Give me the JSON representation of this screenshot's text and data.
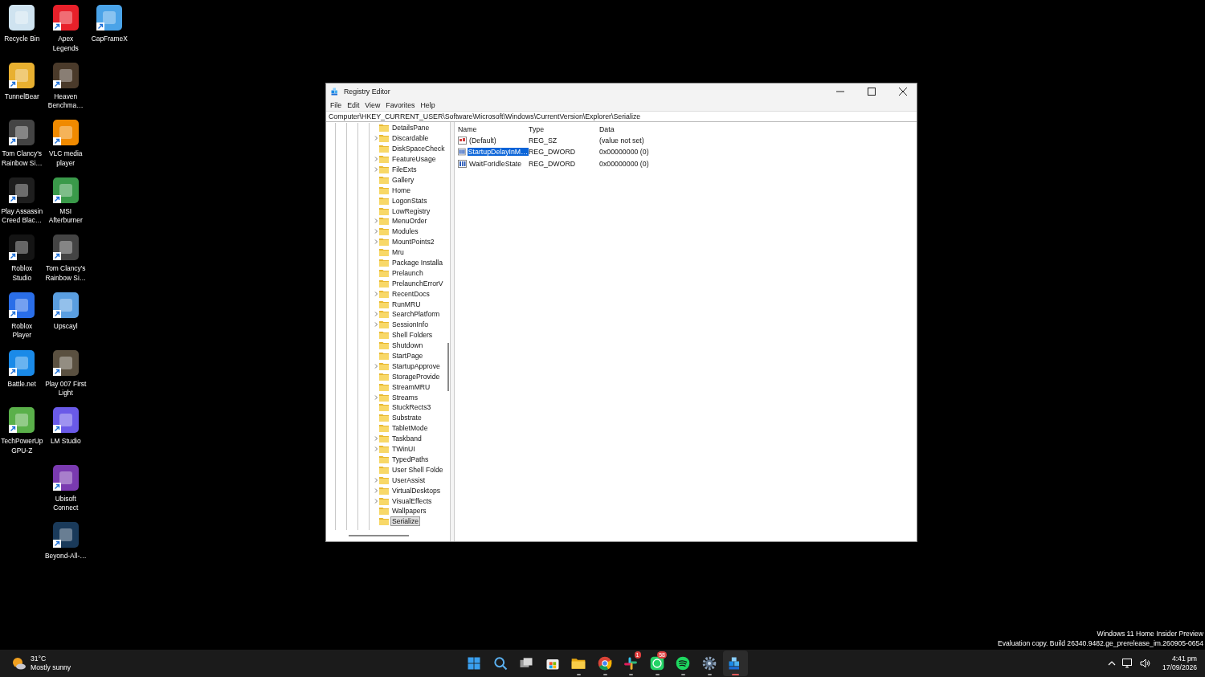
{
  "desktop": {
    "columns": [
      {
        "icons": [
          {
            "label": "Recycle Bin",
            "color": "#cfe3f0",
            "shortcut": false
          },
          {
            "label": "TunnelBear",
            "color": "#e8b030",
            "shortcut": true
          },
          {
            "label": "Tom Clancy's Rainbow Si…",
            "color": "#444444",
            "shortcut": true
          },
          {
            "label": "Play Assassin Creed Blac…",
            "color": "#1e1e1e",
            "shortcut": true
          },
          {
            "label": "Roblox Studio",
            "color": "#141414",
            "shortcut": true
          },
          {
            "label": "Roblox Player",
            "color": "#2a6ee8",
            "shortcut": true
          },
          {
            "label": "Battle.net",
            "color": "#1a8ae8",
            "shortcut": true
          },
          {
            "label": "TechPowerUp GPU-Z",
            "color": "#5ab04a",
            "shortcut": true
          }
        ]
      },
      {
        "icons": [
          {
            "label": "Apex Legends",
            "color": "#e8202a",
            "shortcut": true
          },
          {
            "label": "Heaven Benchma…",
            "color": "#4a3a2a",
            "shortcut": true
          },
          {
            "label": "VLC media player",
            "color": "#f08a00",
            "shortcut": true
          },
          {
            "label": "MSI Afterburner",
            "color": "#3a9a4a",
            "shortcut": true
          },
          {
            "label": "Tom Clancy's Rainbow Si…",
            "color": "#444444",
            "shortcut": true
          },
          {
            "label": "Upscayl",
            "color": "#5a9ee0",
            "shortcut": true
          },
          {
            "label": "Play 007 First Light",
            "color": "#5a5040",
            "shortcut": true
          },
          {
            "label": "LM Studio",
            "color": "#6a5ae8",
            "shortcut": true
          },
          {
            "label": "Ubisoft Connect",
            "color": "#7a3ab0",
            "shortcut": true
          },
          {
            "label": "Beyond-All-…",
            "color": "#1a3a5a",
            "shortcut": true
          }
        ]
      },
      {
        "icons": [
          {
            "label": "CapFrameX",
            "color": "#4aa3e8",
            "shortcut": true
          }
        ]
      }
    ]
  },
  "window": {
    "title": "Registry Editor",
    "menu": [
      "File",
      "Edit",
      "View",
      "Favorites",
      "Help"
    ],
    "address": "Computer\\HKEY_CURRENT_USER\\Software\\Microsoft\\Windows\\CurrentVersion\\Explorer\\Serialize",
    "tree": {
      "items": [
        {
          "label": "DetailsPane",
          "expandable": false,
          "selected": false
        },
        {
          "label": "Discardable",
          "expandable": true,
          "selected": false
        },
        {
          "label": "DiskSpaceCheck",
          "expandable": false,
          "selected": false
        },
        {
          "label": "FeatureUsage",
          "expandable": true,
          "selected": false
        },
        {
          "label": "FileExts",
          "expandable": true,
          "selected": false
        },
        {
          "label": "Gallery",
          "expandable": false,
          "selected": false
        },
        {
          "label": "Home",
          "expandable": false,
          "selected": false
        },
        {
          "label": "LogonStats",
          "expandable": false,
          "selected": false
        },
        {
          "label": "LowRegistry",
          "expandable": false,
          "selected": false
        },
        {
          "label": "MenuOrder",
          "expandable": true,
          "selected": false
        },
        {
          "label": "Modules",
          "expandable": true,
          "selected": false
        },
        {
          "label": "MountPoints2",
          "expandable": true,
          "selected": false
        },
        {
          "label": "Mru",
          "expandable": false,
          "selected": false
        },
        {
          "label": "Package Installa",
          "expandable": false,
          "selected": false
        },
        {
          "label": "Prelaunch",
          "expandable": false,
          "selected": false
        },
        {
          "label": "PrelaunchErrorV",
          "expandable": false,
          "selected": false
        },
        {
          "label": "RecentDocs",
          "expandable": true,
          "selected": false
        },
        {
          "label": "RunMRU",
          "expandable": false,
          "selected": false
        },
        {
          "label": "SearchPlatform",
          "expandable": true,
          "selected": false
        },
        {
          "label": "SessionInfo",
          "expandable": true,
          "selected": false
        },
        {
          "label": "Shell Folders",
          "expandable": false,
          "selected": false
        },
        {
          "label": "Shutdown",
          "expandable": false,
          "selected": false
        },
        {
          "label": "StartPage",
          "expandable": false,
          "selected": false
        },
        {
          "label": "StartupApprove",
          "expandable": true,
          "selected": false
        },
        {
          "label": "StorageProvide",
          "expandable": false,
          "selected": false
        },
        {
          "label": "StreamMRU",
          "expandable": false,
          "selected": false
        },
        {
          "label": "Streams",
          "expandable": true,
          "selected": false
        },
        {
          "label": "StuckRects3",
          "expandable": false,
          "selected": false
        },
        {
          "label": "Substrate",
          "expandable": false,
          "selected": false
        },
        {
          "label": "TabletMode",
          "expandable": false,
          "selected": false
        },
        {
          "label": "Taskband",
          "expandable": true,
          "selected": false
        },
        {
          "label": "TWinUI",
          "expandable": true,
          "selected": false
        },
        {
          "label": "TypedPaths",
          "expandable": false,
          "selected": false
        },
        {
          "label": "User Shell Folde",
          "expandable": false,
          "selected": false
        },
        {
          "label": "UserAssist",
          "expandable": true,
          "selected": false
        },
        {
          "label": "VirtualDesktops",
          "expandable": true,
          "selected": false
        },
        {
          "label": "VisualEffects",
          "expandable": true,
          "selected": false
        },
        {
          "label": "Wallpapers",
          "expandable": false,
          "selected": false
        },
        {
          "label": "Serialize",
          "expandable": false,
          "selected": true
        }
      ]
    },
    "values": {
      "columns": [
        "Name",
        "Type",
        "Data"
      ],
      "rows": [
        {
          "kind": "string",
          "name": "(Default)",
          "type": "REG_SZ",
          "data": "(value not set)",
          "selected": false
        },
        {
          "kind": "binary",
          "name": "StartupDelayInM…",
          "type": "REG_DWORD",
          "data": "0x00000000 (0)",
          "selected": true
        },
        {
          "kind": "binary",
          "name": "WaitForIdleState",
          "type": "REG_DWORD",
          "data": "0x00000000 (0)",
          "selected": false
        }
      ]
    }
  },
  "watermark": {
    "line_1": "Windows 11 Home Insider Preview",
    "line_2": "Evaluation copy. Build 26340.9482.ge_prerelease_im.260905-0654"
  },
  "taskbar": {
    "weather": {
      "temperature": "31°C",
      "condition": "Mostly sunny"
    },
    "apps": [
      {
        "kind": "start",
        "running": false,
        "selected": false
      },
      {
        "kind": "search",
        "running": false,
        "selected": false
      },
      {
        "kind": "taskview",
        "running": false,
        "selected": false
      },
      {
        "kind": "store",
        "running": false,
        "selected": false
      },
      {
        "kind": "folder",
        "running": true,
        "selected": false
      },
      {
        "kind": "chrome",
        "running": true,
        "selected": false
      },
      {
        "kind": "slack",
        "running": true,
        "selected": false,
        "badge": "1"
      },
      {
        "kind": "whatsapp",
        "running": true,
        "selected": false,
        "badge": "58"
      },
      {
        "kind": "spotify",
        "running": true,
        "selected": false
      },
      {
        "kind": "gear",
        "running": true,
        "selected": false
      },
      {
        "kind": "regedit",
        "running": true,
        "selected": true
      }
    ],
    "time": "4:41 pm",
    "date": "17/09/2026"
  }
}
